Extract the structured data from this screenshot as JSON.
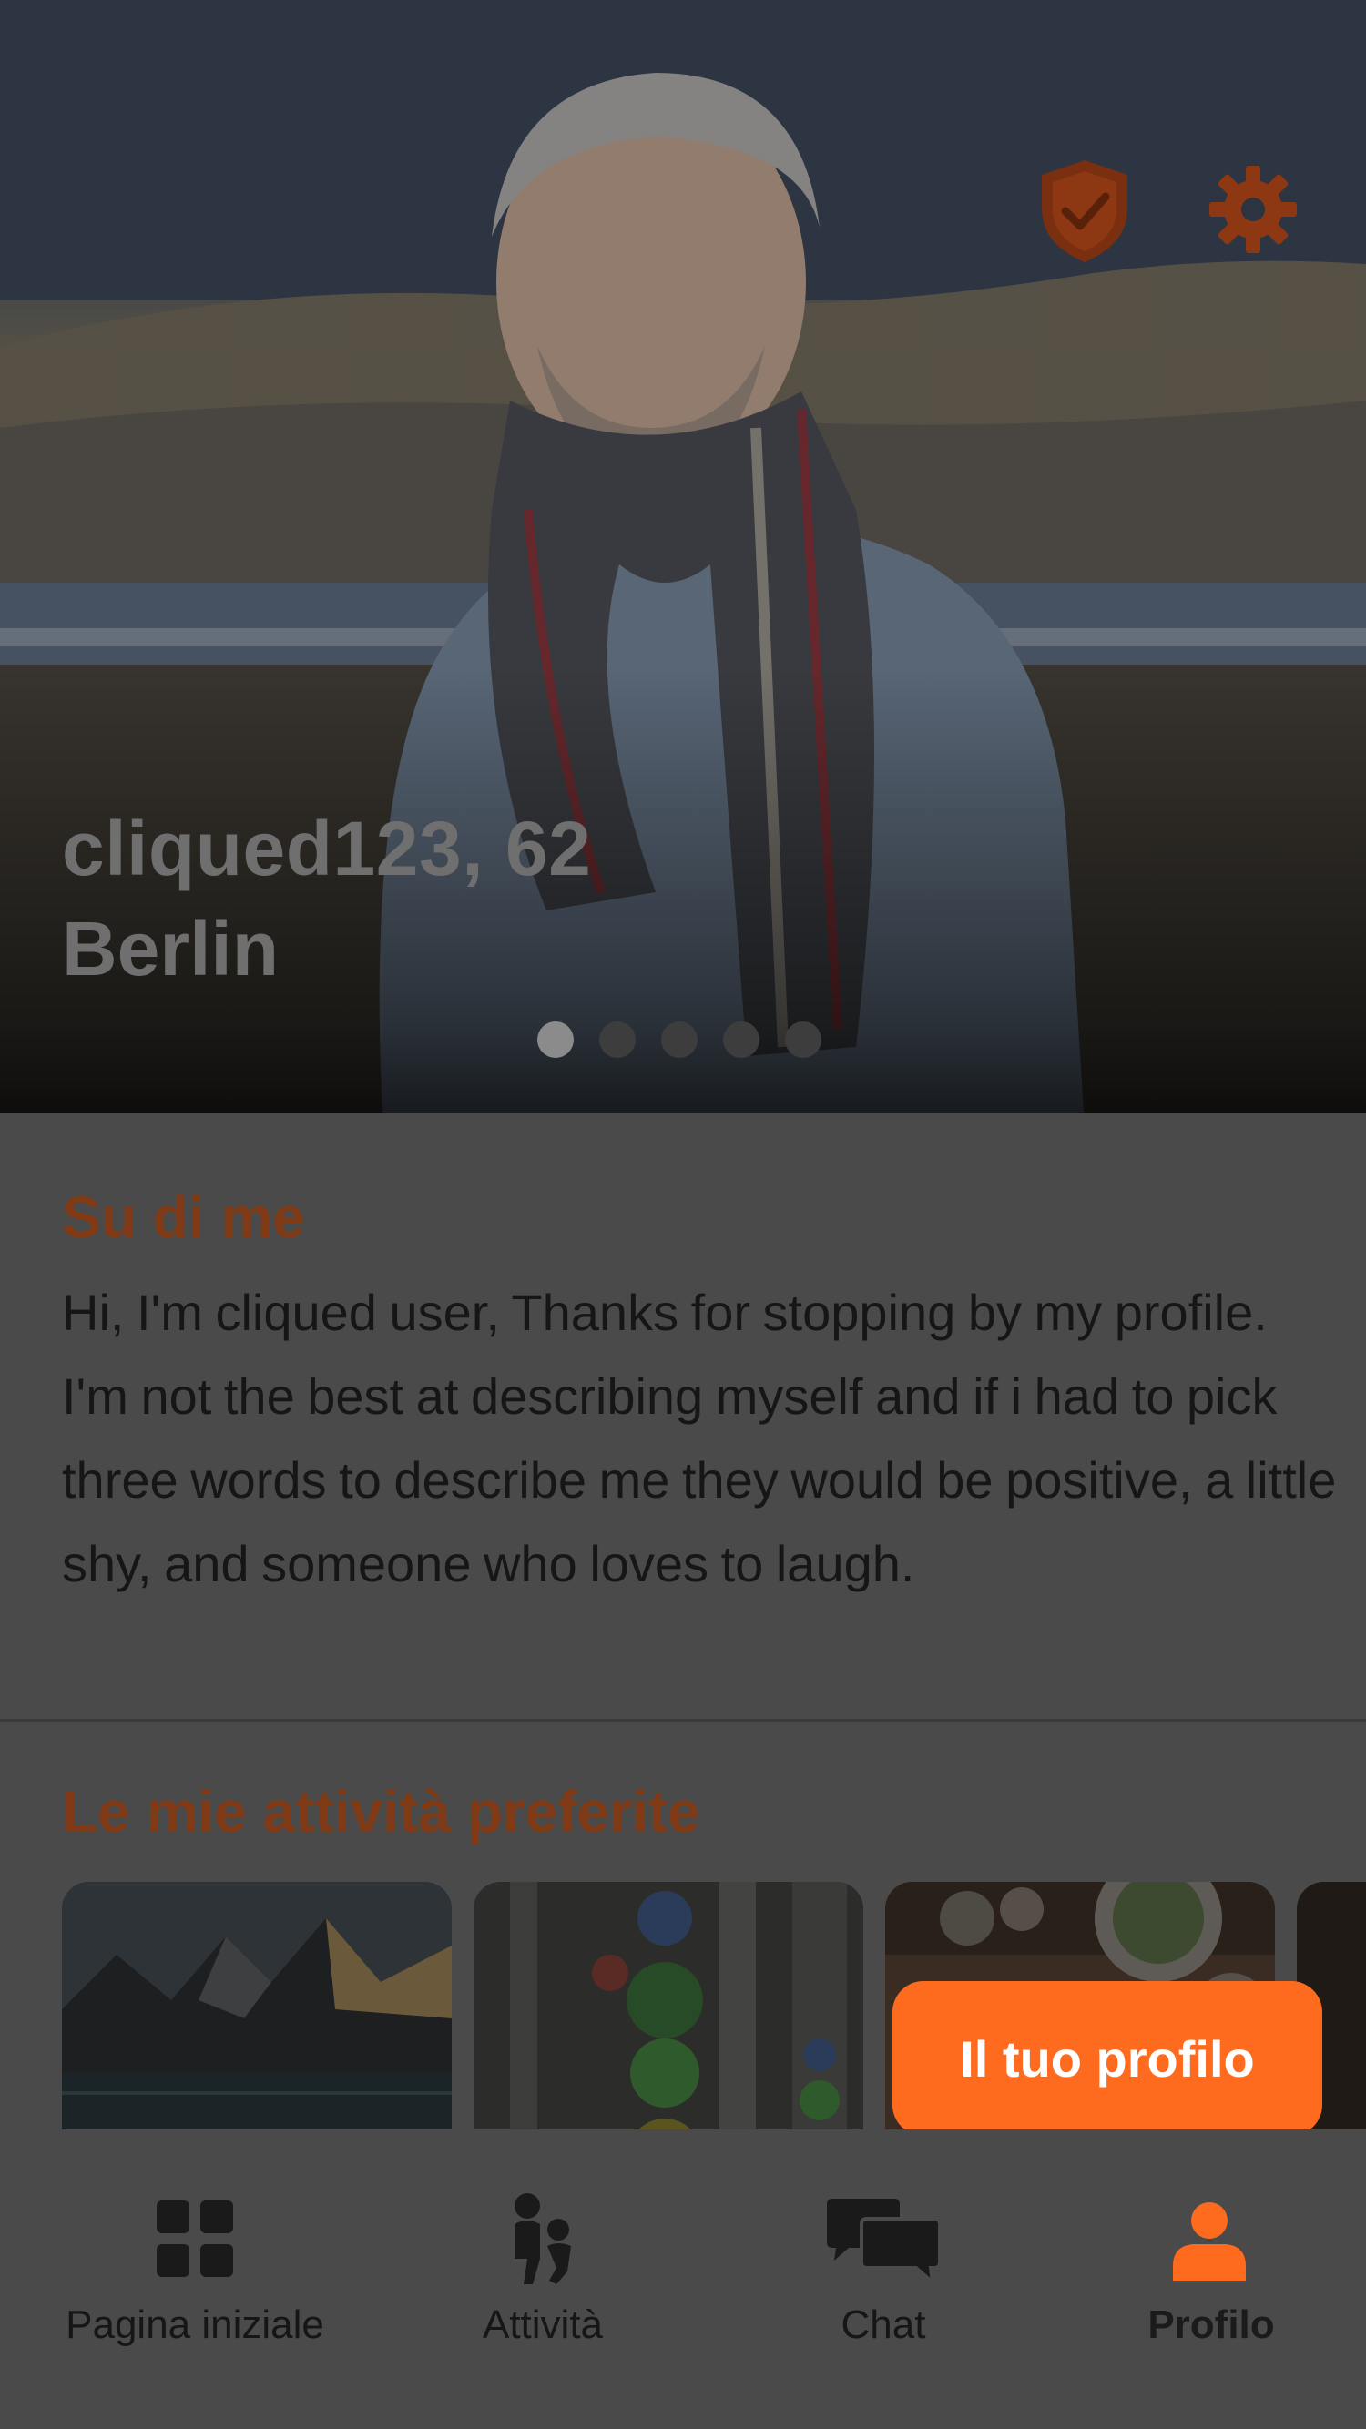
{
  "profile": {
    "name_age": "cliqued123, 62",
    "city": "Berlin",
    "photo_count": 5,
    "active_photo_index": 1
  },
  "header_icons": {
    "verified": "shield-check-icon",
    "settings": "gear-icon"
  },
  "about": {
    "title": "Su di me",
    "text": "Hi, I'm cliqued user, Thanks for stopping by my profile. I'm not the best at describing myself and if i had to pick three words to describe me they would be positive, a little shy, and someone who loves to laugh."
  },
  "activities": {
    "title": "Le mie attività preferite",
    "items": [
      "mountain-lake",
      "gym-weights",
      "dinner-table",
      "more"
    ]
  },
  "tooltip": {
    "text": "Il tuo profilo"
  },
  "nav": {
    "items": [
      {
        "label": "Pagina iniziale",
        "icon": "grid-icon",
        "active": false
      },
      {
        "label": "Attività",
        "icon": "people-icon",
        "active": false
      },
      {
        "label": "Chat",
        "icon": "chat-bubbles-icon",
        "active": false
      },
      {
        "label": "Profilo",
        "icon": "person-icon",
        "active": true
      }
    ]
  },
  "colors": {
    "accent": "#ff6b1e",
    "accent_dim": "#803a16",
    "overlay_bg": "#4a4a4a"
  }
}
